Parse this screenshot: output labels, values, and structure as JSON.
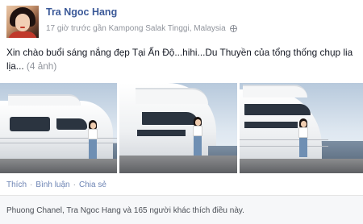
{
  "post": {
    "author": "Tra Ngoc Hang",
    "time": "17 giờ trước",
    "location": "gần Kampong Salak Tinggi, Malaysia",
    "privacy_icon": "globe-icon",
    "status_text": "Xin chào buổi sáng nắng đẹp Tại Ấn Độ...hihi...Du Thuyền của tổng thống chụp lia lịa...",
    "photo_count": "(4 ảnh)",
    "photo_count_num": 4
  },
  "actions": {
    "like": "Thích",
    "comment": "Bình luận",
    "share": "Chia sẻ",
    "separator": "·"
  },
  "likes": {
    "text": "Phuong Chanel, Tra Ngoc Hang và 165 người khác thích điều này."
  },
  "colors": {
    "link_blue": "#3b5998",
    "meta_gray": "#90949c",
    "footer_bg": "#f6f7f9"
  }
}
